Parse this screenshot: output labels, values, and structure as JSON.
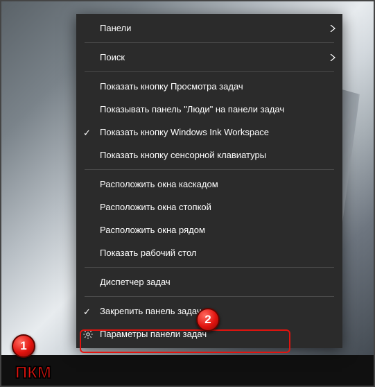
{
  "menu": {
    "panels": "Панели",
    "search": "Поиск",
    "task_view_button": "Показать кнопку Просмотра задач",
    "people_panel": "Показывать панель \"Люди\" на панели задач",
    "ink_workspace": "Показать кнопку Windows Ink Workspace",
    "touch_keyboard": "Показать кнопку сенсорной клавиатуры",
    "cascade": "Расположить окна каскадом",
    "stacked": "Расположить окна стопкой",
    "side_by_side": "Расположить окна рядом",
    "show_desktop": "Показать рабочий стол",
    "task_manager": "Диспетчер задач",
    "lock_taskbar": "Закрепить панель задач",
    "taskbar_settings": "Параметры панели задач"
  },
  "annotations": {
    "badge1": "1",
    "badge2": "2",
    "pkm": "ПКМ"
  }
}
